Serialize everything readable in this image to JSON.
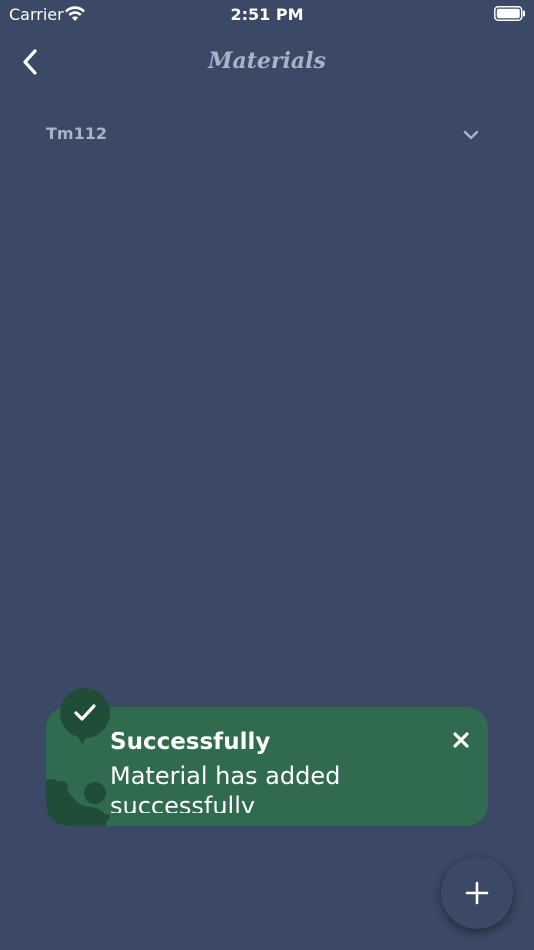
{
  "status_bar": {
    "carrier": "Carrier",
    "time": "2:51 PM",
    "icons": [
      "wifi-icon",
      "battery-icon"
    ]
  },
  "nav": {
    "title": "Materials",
    "back_icon": "chevron-left-icon"
  },
  "dropdown": {
    "selected": "Tm112",
    "icon": "chevron-down-icon"
  },
  "toast": {
    "title": "Successfully",
    "message": "Material has added successfully",
    "icon": "check-icon",
    "close_icon": "close-icon",
    "color": "#306b4f",
    "badge_color": "#1f4d37"
  },
  "fab": {
    "icon": "plus-icon"
  },
  "colors": {
    "background": "#3b4966",
    "muted_text": "#a9b3c7"
  }
}
